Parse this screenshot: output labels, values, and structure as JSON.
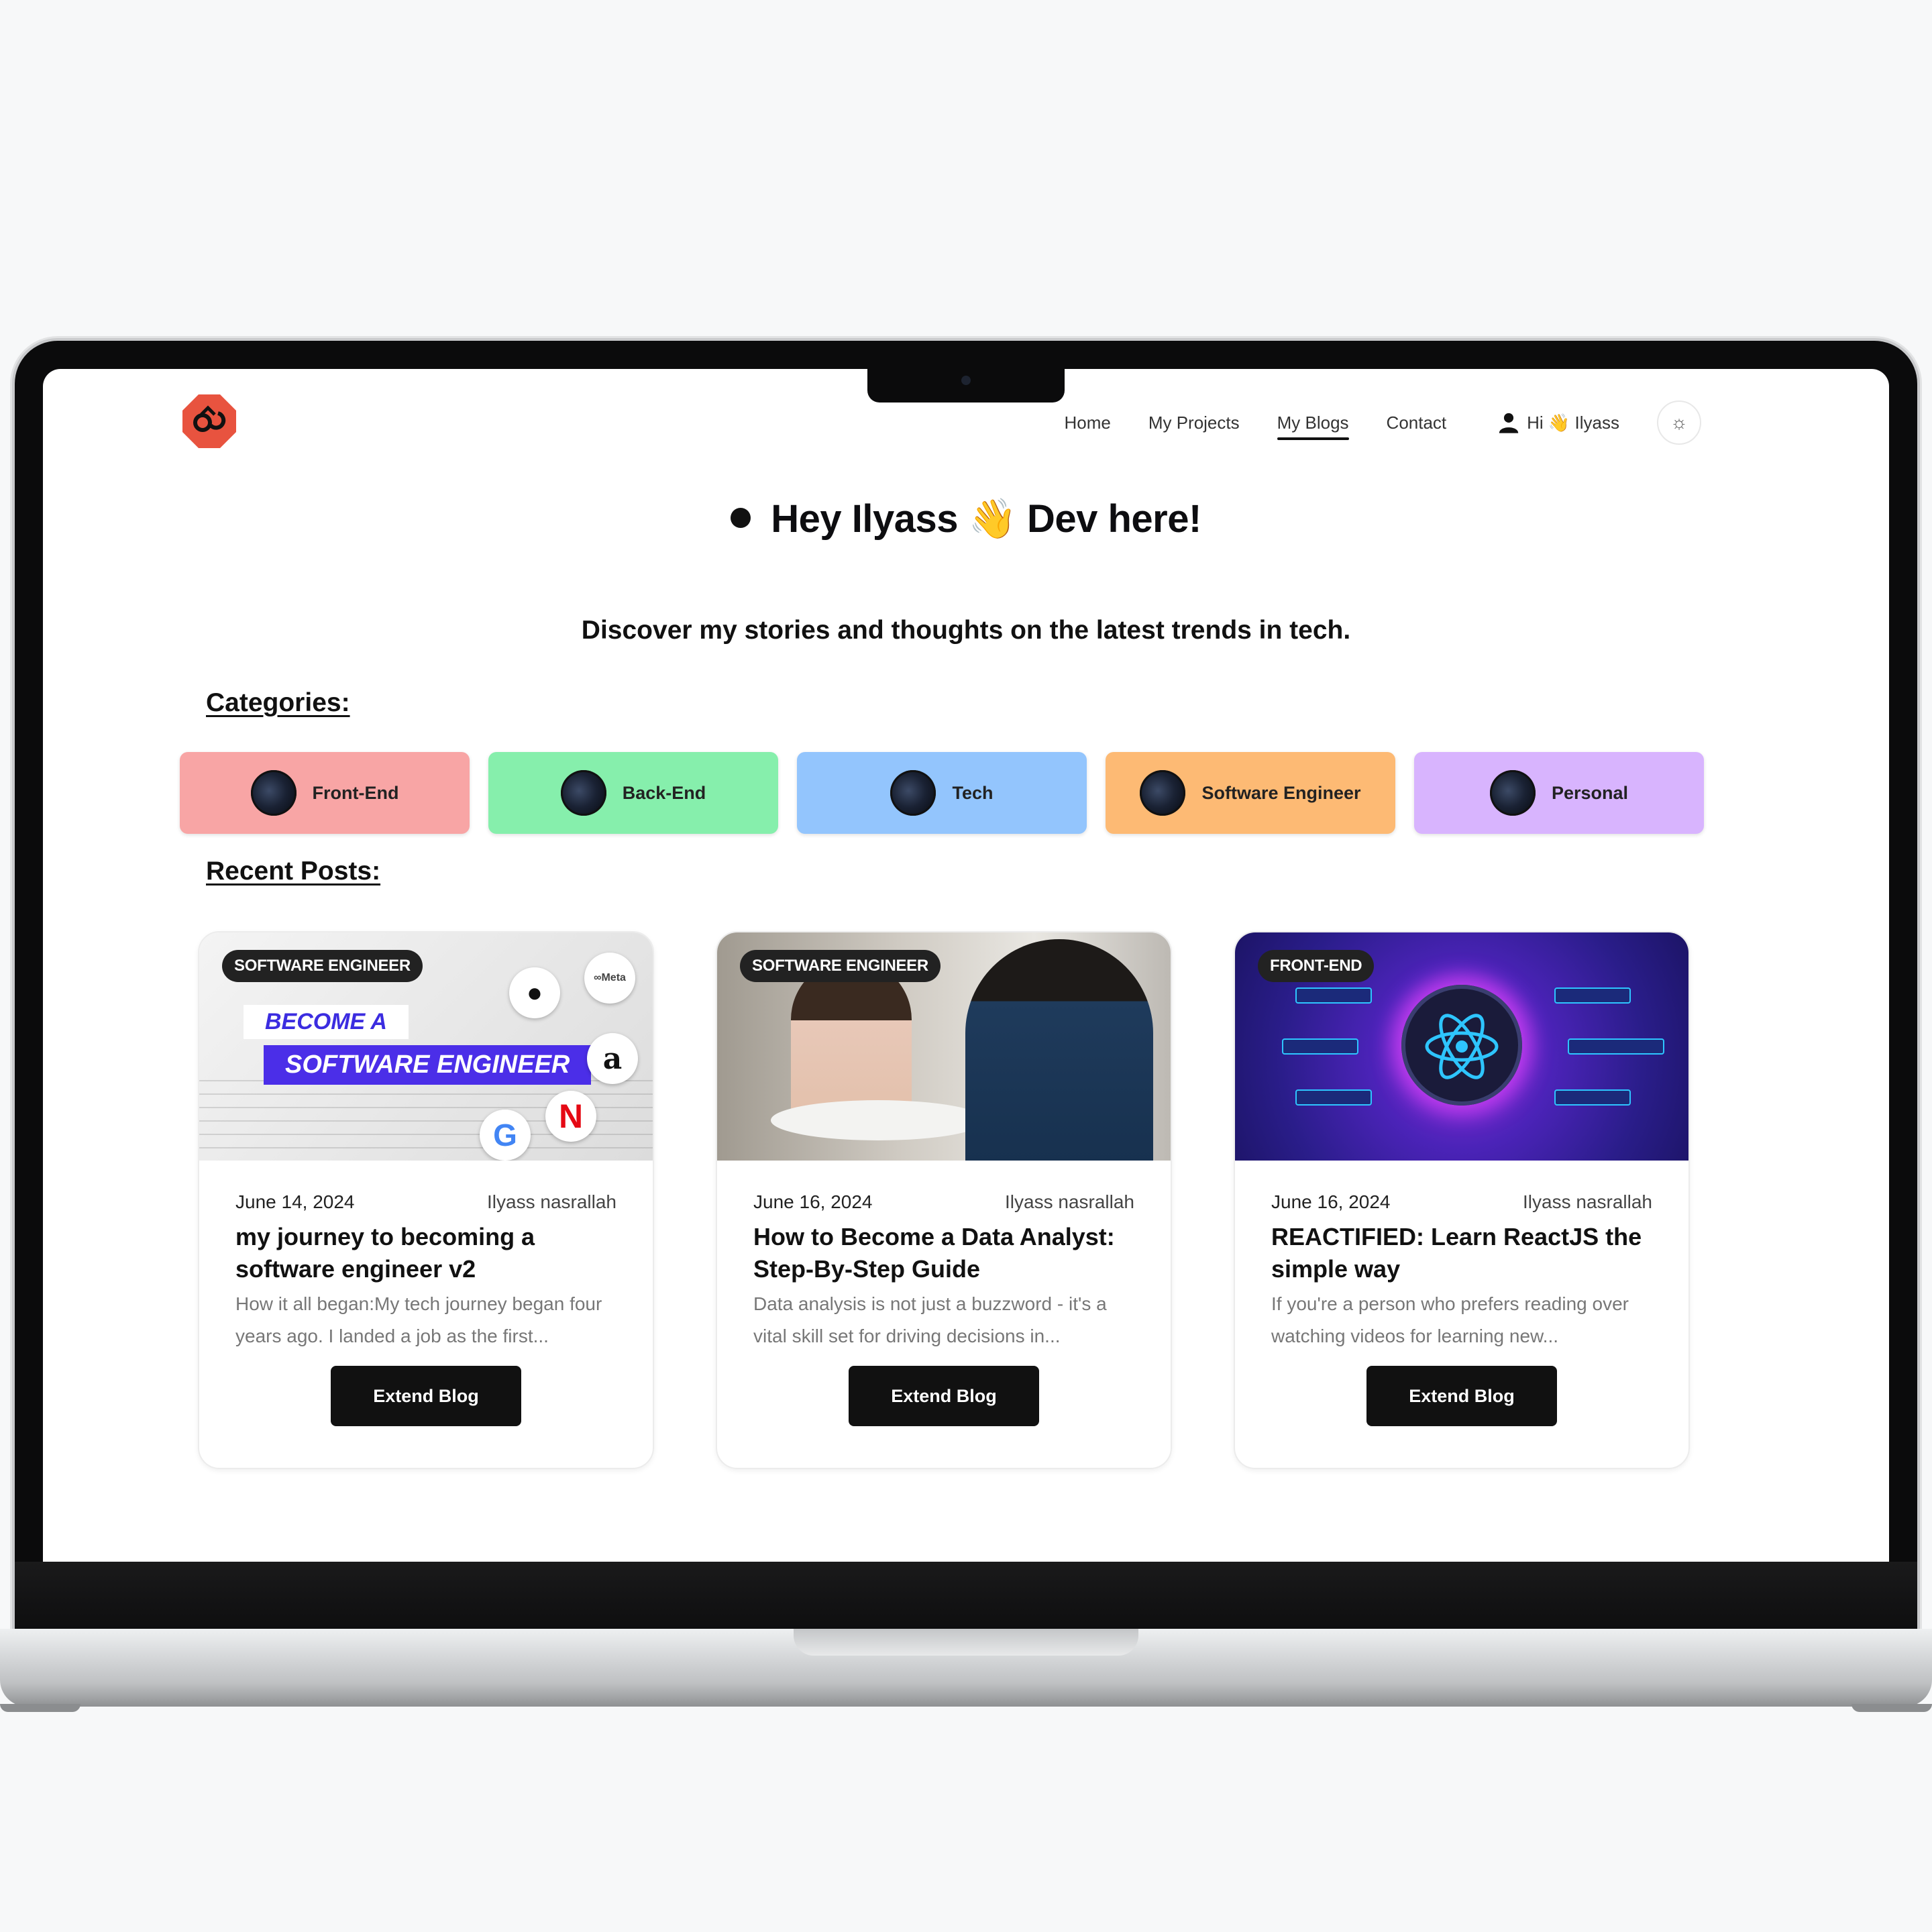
{
  "nav": {
    "links": [
      "Home",
      "My Projects",
      "My Blogs",
      "Contact"
    ],
    "active": "My Blogs",
    "user_greeting": "Hi 👋 Ilyass",
    "user_icon": "user-icon",
    "theme_icon": "sun-icon"
  },
  "hero": {
    "title_part1": "Hey Ilyass",
    "wave_emoji": "👋",
    "title_part2": "Dev here!",
    "subtitle": "Discover my stories and thoughts on the latest trends in tech."
  },
  "sections": {
    "categories": "Categories:",
    "recent": "Recent Posts:"
  },
  "categories": [
    {
      "label": "Front-End",
      "color": "#f8a5a5"
    },
    {
      "label": "Back-End",
      "color": "#86efac"
    },
    {
      "label": "Tech",
      "color": "#93c5fd"
    },
    {
      "label": "Software Engineer",
      "color": "#fdba74"
    },
    {
      "label": "Personal",
      "color": "#d8b4fe"
    }
  ],
  "posts": [
    {
      "badge": "SOFTWARE ENGINEER",
      "date": "June 14, 2024",
      "author": "Ilyass nasrallah",
      "title": "my journey to becoming a software engineer v2",
      "excerpt": "How it all began:My tech journey began four years ago. I landed a job as the first...",
      "button": "Extend Blog",
      "thumb_text_1": "BECOME A",
      "thumb_text_2": "SOFTWARE ENGINEER",
      "thumb_logo_meta": "∞Meta"
    },
    {
      "badge": "SOFTWARE ENGINEER",
      "date": "June 16, 2024",
      "author": "Ilyass nasrallah",
      "title": "How to Become a Data Analyst: Step-By-Step Guide",
      "excerpt": "Data analysis is not just a buzzword - it's a vital skill set for driving decisions in...",
      "button": "Extend Blog"
    },
    {
      "badge": "FRONT-END",
      "date": "June 16, 2024",
      "author": "Ilyass nasrallah",
      "title": "REACTIFIED: Learn ReactJS the simple way",
      "excerpt": "If you're a person who prefers reading over watching videos for learning new...",
      "button": "Extend Blog"
    }
  ]
}
